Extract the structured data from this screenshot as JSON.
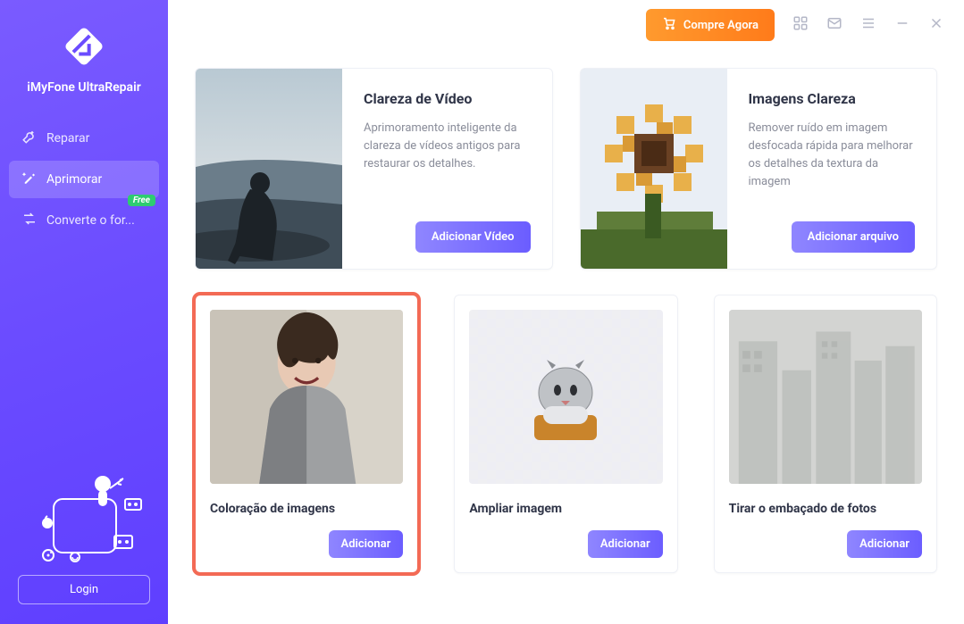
{
  "app_name": "iMyFone UltraRepair",
  "sidebar": {
    "items": [
      {
        "icon": "tools-icon",
        "label": "Reparar"
      },
      {
        "icon": "magic-icon",
        "label": "Aprimorar"
      },
      {
        "icon": "convert-icon",
        "label": "Converte o for...",
        "badge": "Free"
      }
    ]
  },
  "login_label": "Login",
  "buy_label": "Compre Agora",
  "features_top": [
    {
      "title": "Clareza de Vídeo",
      "desc": "Aprimoramento inteligente da clareza de vídeos antigos para restaurar os detalhes.",
      "button": "Adicionar Vídeo"
    },
    {
      "title": "Imagens Clareza",
      "desc": "Remover ruído em imagem desfocada rápida  para melhorar os detalhes da textura da imagem",
      "button": "Adicionar arquivo"
    }
  ],
  "features_bottom": [
    {
      "title": "Coloração de imagens",
      "button": "Adicionar",
      "highlighted": true
    },
    {
      "title": "Ampliar imagem",
      "button": "Adicionar"
    },
    {
      "title": "Tirar o embaçado de fotos",
      "button": "Adicionar"
    }
  ]
}
